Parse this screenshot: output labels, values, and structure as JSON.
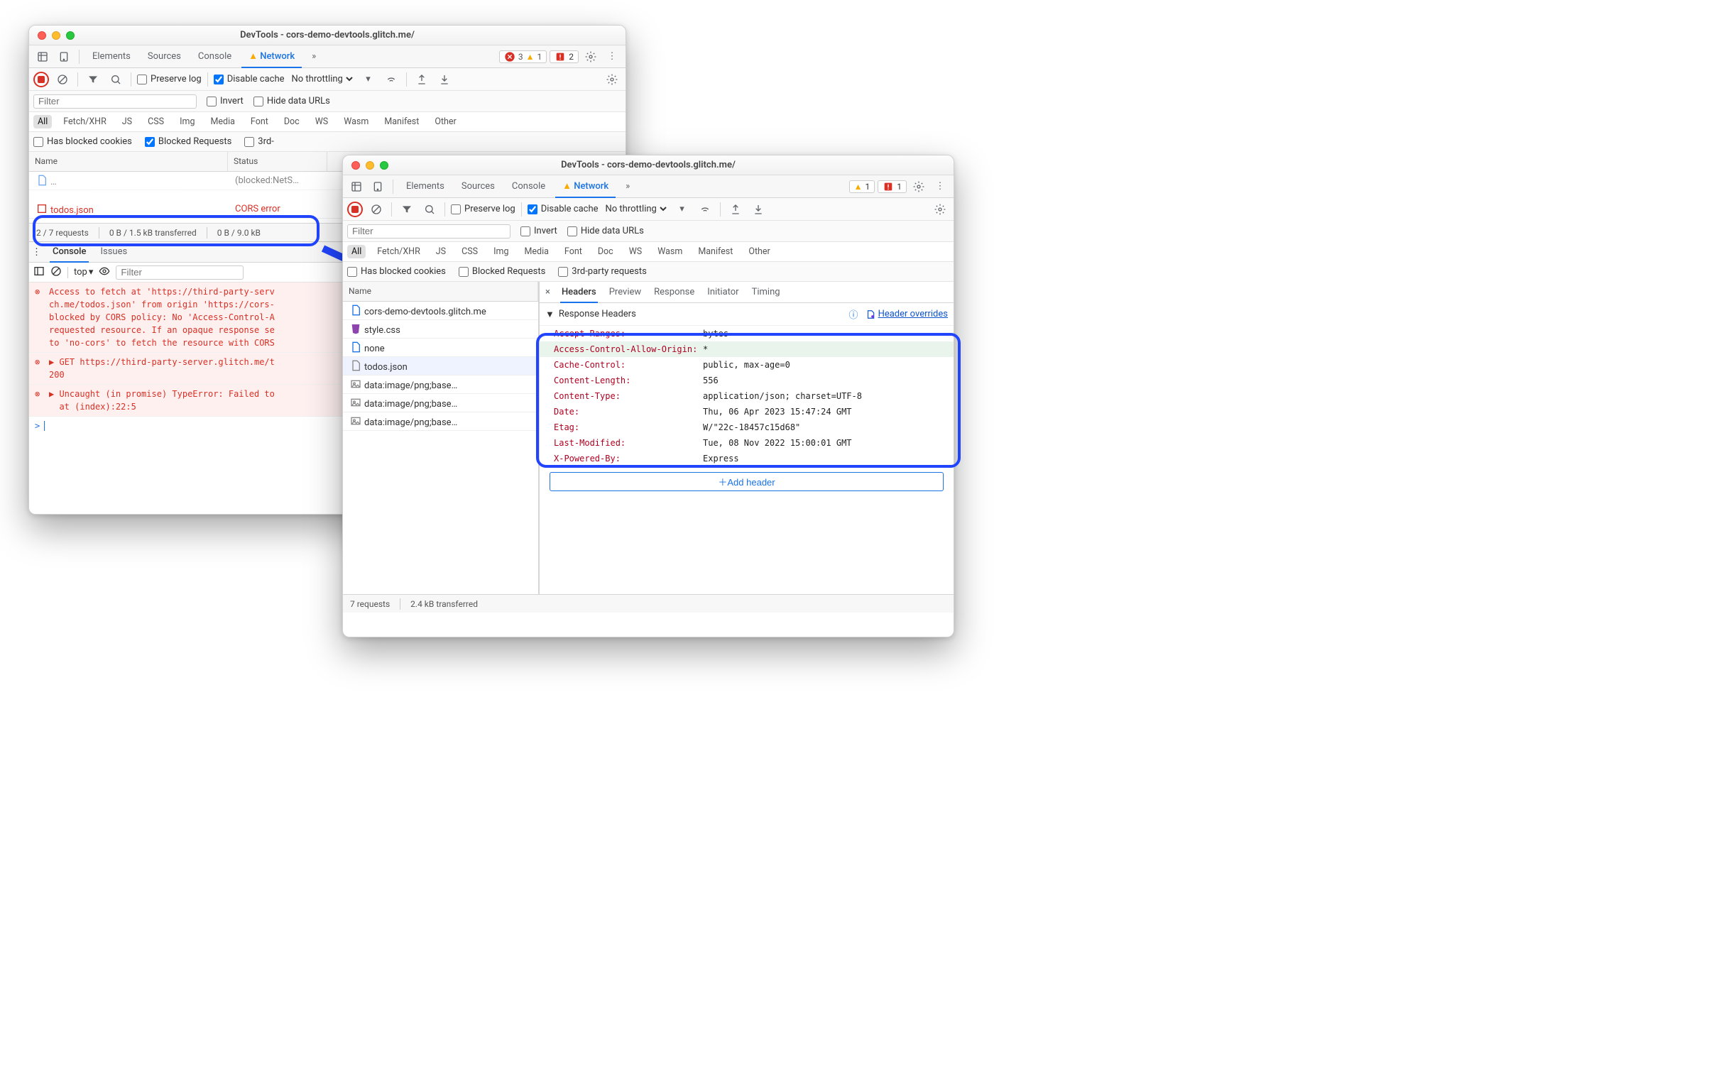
{
  "win1": {
    "title": "DevTools - cors-demo-devtools.glitch.me/",
    "tabs": [
      "Elements",
      "Sources",
      "Console",
      "Network"
    ],
    "active_tab": "Network",
    "err_count": "3",
    "warn_count": "1",
    "issue_count": "2",
    "preserve_log": "Preserve log",
    "disable_cache": "Disable cache",
    "throttling": "No throttling",
    "filter_placeholder": "Filter",
    "invert": "Invert",
    "hide_data_urls": "Hide data URLs",
    "types": [
      "All",
      "Fetch/XHR",
      "JS",
      "CSS",
      "Img",
      "Media",
      "Font",
      "Doc",
      "WS",
      "Wasm",
      "Manifest",
      "Other"
    ],
    "hbc": "Has blocked cookies",
    "blocked": "Blocked Requests",
    "third": "3rd-",
    "table_cols": [
      "Name",
      "Status"
    ],
    "row_trunc_name": "…",
    "row_trunc_status": "(blocked:NetS…",
    "row_err_name": "todos.json",
    "row_err_status": "CORS error",
    "status1": "2 / 7 requests",
    "status2": "0 B / 1.5 kB transferred",
    "status3": "0 B / 9.0 kB",
    "drawer_tabs": [
      "Console",
      "Issues"
    ],
    "ctx": "top",
    "eye_filter_placeholder": "Filter",
    "msg1": "Access to fetch at 'https://third-party-serv\nch.me/todos.json' from origin 'https://cors-\nblocked by CORS policy: No 'Access-Control-A\nrequested resource. If an opaque response se\nto 'no-cors' to fetch the resource with CORS",
    "msg2": "▶ GET https://third-party-server.glitch.me/t\n200",
    "msg3": "▶ Uncaught (in promise) TypeError: Failed to\n  at (index):22:5"
  },
  "win2": {
    "title": "DevTools - cors-demo-devtools.glitch.me/",
    "tabs": [
      "Elements",
      "Sources",
      "Console",
      "Network"
    ],
    "active_tab": "Network",
    "warn_count": "1",
    "issue_count": "1",
    "preserve_log": "Preserve log",
    "disable_cache": "Disable cache",
    "throttling": "No throttling",
    "filter_placeholder": "Filter",
    "invert": "Invert",
    "hide_data_urls": "Hide data URLs",
    "types": [
      "All",
      "Fetch/XHR",
      "JS",
      "CSS",
      "Img",
      "Media",
      "Font",
      "Doc",
      "WS",
      "Wasm",
      "Manifest",
      "Other"
    ],
    "hbc": "Has blocked cookies",
    "blocked": "Blocked Requests",
    "third": "3rd-party requests",
    "table_col": "Name",
    "rows": [
      {
        "name": "cors-demo-devtools.glitch.me",
        "icon": "doc"
      },
      {
        "name": "style.css",
        "icon": "css"
      },
      {
        "name": "none",
        "icon": "doc"
      },
      {
        "name": "todos.json",
        "icon": "file",
        "selected": true
      },
      {
        "name": "data:image/png;base…",
        "icon": "img"
      },
      {
        "name": "data:image/png;base…",
        "icon": "img"
      },
      {
        "name": "data:image/png;base…",
        "icon": "img"
      }
    ],
    "status1": "7 requests",
    "status2": "2.4 kB transferred",
    "detail": {
      "tabs": [
        "Headers",
        "Preview",
        "Response",
        "Initiator",
        "Timing"
      ],
      "active": "Headers",
      "section": "Response Headers",
      "override_link": "Header overrides",
      "headers": [
        {
          "k": "Accept-Ranges:",
          "v": "bytes"
        },
        {
          "k": "Access-Control-Allow-Origin:",
          "v": "*",
          "added": true
        },
        {
          "k": "Cache-Control:",
          "v": "public, max-age=0"
        },
        {
          "k": "Content-Length:",
          "v": "556"
        },
        {
          "k": "Content-Type:",
          "v": "application/json; charset=UTF-8"
        },
        {
          "k": "Date:",
          "v": "Thu, 06 Apr 2023 15:47:24 GMT"
        },
        {
          "k": "Etag:",
          "v": "W/\"22c-18457c15d68\""
        },
        {
          "k": "Last-Modified:",
          "v": "Tue, 08 Nov 2022 15:00:01 GMT"
        },
        {
          "k": "X-Powered-By:",
          "v": "Express"
        }
      ],
      "add_header": "Add header"
    }
  }
}
